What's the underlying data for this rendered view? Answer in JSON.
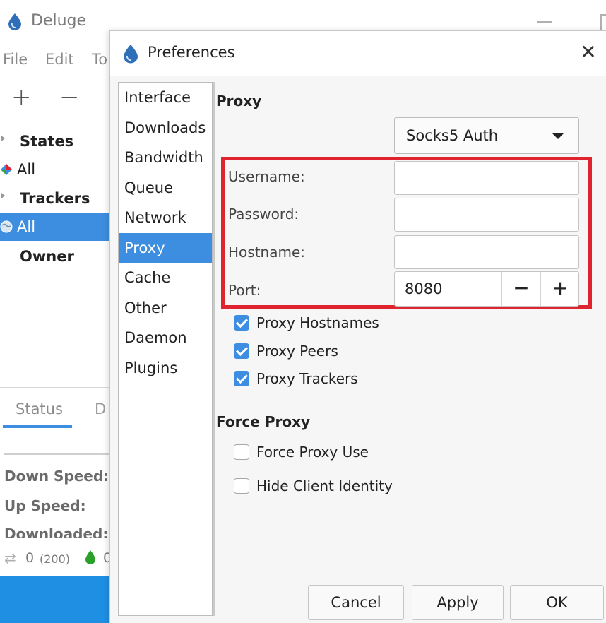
{
  "main_window": {
    "title": "Deluge",
    "menu": [
      "File",
      "Edit",
      "To"
    ],
    "toolbar": {
      "add": "+",
      "remove": "−"
    },
    "sidebar": {
      "states_header": "States",
      "states_all": "All",
      "trackers_header": "Trackers",
      "trackers_all": "All",
      "owner_header": "Owner"
    },
    "details_tabs": {
      "status": "Status",
      "second": "D"
    },
    "stats": {
      "down_speed": "Down Speed:",
      "up_speed": "Up Speed:",
      "downloaded": "Downloaded:"
    },
    "statusbar": {
      "connections": "0",
      "connections_max": "(200)",
      "download_value": "0"
    }
  },
  "dialog": {
    "title": "Preferences",
    "close_glyph": "✕",
    "categories": [
      "Interface",
      "Downloads",
      "Bandwidth",
      "Queue",
      "Network",
      "Proxy",
      "Cache",
      "Other",
      "Daemon",
      "Plugins"
    ],
    "selected_category": "Proxy",
    "proxy": {
      "heading": "Proxy",
      "type": "Socks5 Auth",
      "username_label": "Username:",
      "username_value": "",
      "password_label": "Password:",
      "password_value": "",
      "hostname_label": "Hostname:",
      "hostname_value": "",
      "port_label": "Port:",
      "port_value": "8080",
      "port_decrement": "−",
      "port_increment": "+",
      "proxy_hostnames_label": "Proxy Hostnames",
      "proxy_hostnames_checked": true,
      "proxy_peers_label": "Proxy Peers",
      "proxy_peers_checked": true,
      "proxy_trackers_label": "Proxy Trackers",
      "proxy_trackers_checked": true
    },
    "force_proxy": {
      "heading": "Force Proxy",
      "force_proxy_use_label": "Force Proxy Use",
      "force_proxy_use_checked": false,
      "hide_client_identity_label": "Hide Client Identity",
      "hide_client_identity_checked": false
    },
    "buttons": {
      "cancel": "Cancel",
      "apply": "Apply",
      "ok": "OK"
    }
  },
  "colors": {
    "accent": "#3d8ee0",
    "highlight": "#e0242f",
    "status_bar": "#1f8fe4"
  }
}
